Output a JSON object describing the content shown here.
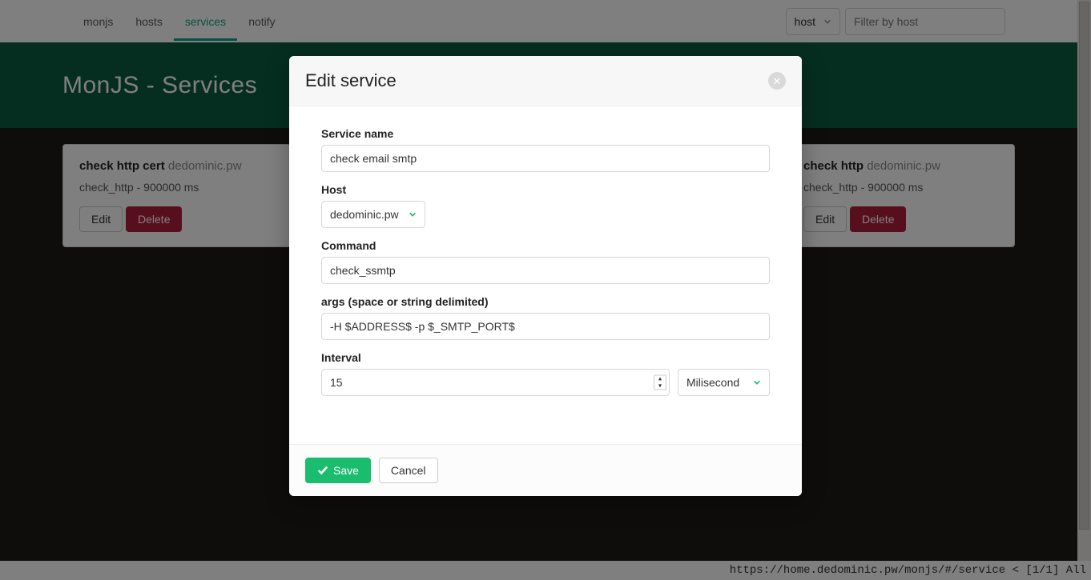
{
  "nav": {
    "items": [
      "monjs",
      "hosts",
      "services",
      "notify"
    ],
    "activeIndex": 2
  },
  "filter": {
    "selectValue": "host",
    "placeholder": "Filter by host"
  },
  "hero": {
    "title": "MonJS - Services"
  },
  "cards": [
    {
      "titleBold": "check http cert",
      "titleMuted": "dedominic.pw",
      "sub": "check_http - 900000 ms",
      "editLabel": "Edit",
      "deleteLabel": "Delete"
    },
    {
      "titleBold": "check http",
      "titleMuted": "dedominic.pw",
      "sub": "check_http - 900000 ms",
      "editLabel": "Edit",
      "deleteLabel": "Delete"
    }
  ],
  "modal": {
    "title": "Edit service",
    "labels": {
      "serviceName": "Service name",
      "host": "Host",
      "command": "Command",
      "args": "args (space or string delimited)",
      "interval": "Interval"
    },
    "values": {
      "serviceName": "check email smtp",
      "host": "dedominic.pw",
      "command": "check_ssmtp",
      "args": "-H $ADDRESS$ -p $_SMTP_PORT$",
      "interval": "15",
      "intervalUnit": "Milisecond"
    },
    "buttons": {
      "save": "Save",
      "cancel": "Cancel"
    }
  },
  "status": {
    "url": "https://home.dedominic.pw/monjs/#/service",
    "suffix": "< [1/1] All"
  }
}
